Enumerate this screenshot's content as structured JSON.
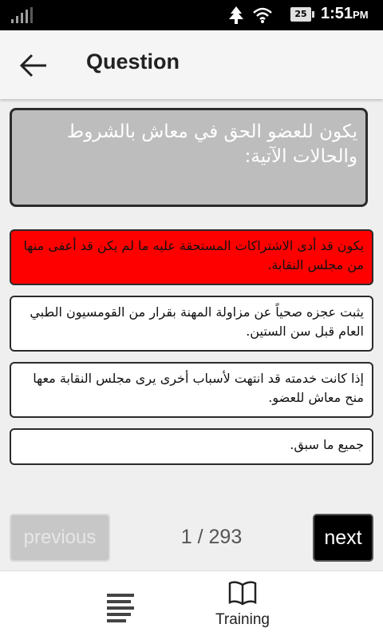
{
  "status_bar": {
    "battery": "25",
    "time": "1:51",
    "ampm": "PM",
    "icons": [
      "signal-icon",
      "tree-icon",
      "wifi-icon",
      "battery-icon"
    ]
  },
  "app_bar": {
    "title": "Question",
    "back_icon": "arrow-left-icon"
  },
  "question": {
    "text": "يكون للعضو الحق في معاش بالشروط والحالات الآتية:"
  },
  "options": [
    {
      "text": "يكون قد أدى الاشتراكات المستحقة عليه ما لم يكن قد أعفى منها من مجلس النقابة.",
      "selected": true
    },
    {
      "text": "يثبت عجزه صحياً عن مزاولة المهنة بقرار من القومسيون الطبي العام قبل سن الستين.",
      "selected": false
    },
    {
      "text": "إذا كانت خدمته قد انتهت لأسباب أخرى يرى مجلس النقابة معها منح معاش للعضو.",
      "selected": false
    },
    {
      "text": "جميع ما سبق.",
      "selected": false
    }
  ],
  "navigation": {
    "previous_label": "previous",
    "counter": "1 / 293",
    "next_label": "next"
  },
  "bottom_nav": {
    "menu_icon": "list-icon",
    "training_icon": "book-icon",
    "training_label": "Training"
  },
  "colors": {
    "selected_option": "#ff0000",
    "question_box": "#bdbdbd",
    "next_button": "#000000"
  }
}
